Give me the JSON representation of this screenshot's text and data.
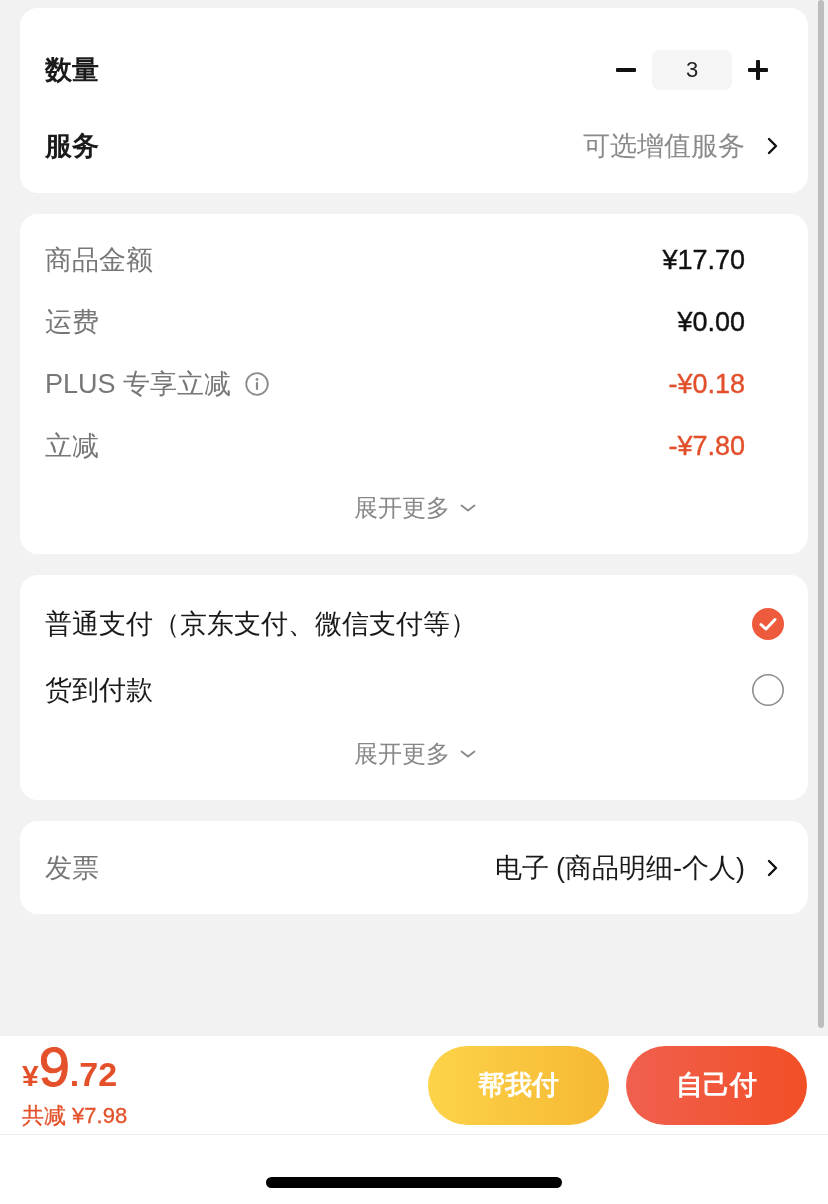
{
  "options_card": {
    "quantity": {
      "label": "数量",
      "value": "3"
    },
    "service": {
      "label": "服务",
      "value": "可选增值服务"
    }
  },
  "price_rows": [
    {
      "label": "商品金额",
      "value": "¥17.70",
      "kind": "amount",
      "info": false
    },
    {
      "label": "运费",
      "value": "¥0.00",
      "kind": "amount",
      "info": false
    },
    {
      "label": "PLUS 专享立减",
      "value": "-¥0.18",
      "kind": "discount",
      "info": true
    },
    {
      "label": "立减",
      "value": "-¥7.80",
      "kind": "discount",
      "info": false
    }
  ],
  "price_more": "展开更多",
  "payment_methods": [
    {
      "label": "普通支付（京东支付、微信支付等）",
      "selected": true
    },
    {
      "label": "货到付款",
      "selected": false
    }
  ],
  "payment_more": "展开更多",
  "invoice": {
    "label": "发票",
    "value": "电子 (商品明细-个人)"
  },
  "footer": {
    "total": {
      "currency": "¥",
      "integer": "9",
      "decimal": ".72"
    },
    "saved": "共减 ¥7.98",
    "buttons": [
      {
        "label": "帮我付",
        "kind": "secondary"
      },
      {
        "label": "自己付",
        "kind": "primary"
      }
    ]
  }
}
